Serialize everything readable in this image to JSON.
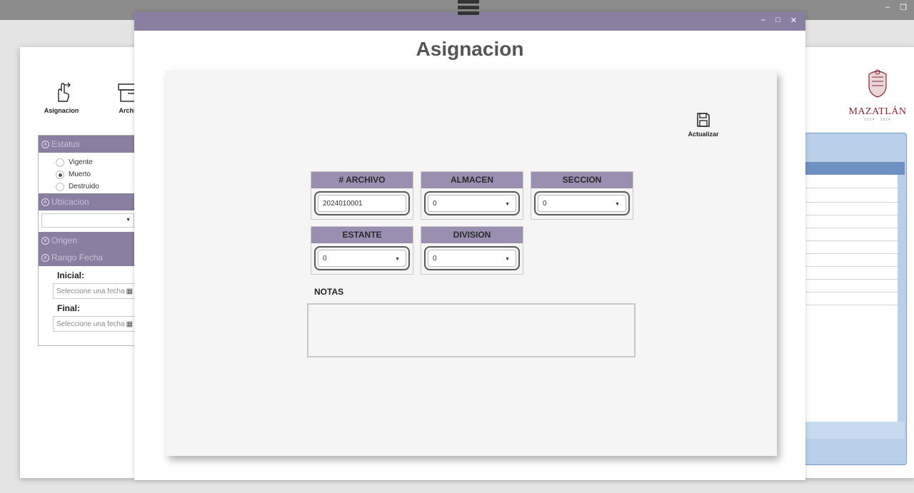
{
  "background_window": {
    "toolbar": [
      {
        "label": "Asignacion",
        "icon": "hand-pointer-icon"
      },
      {
        "label": "Archi",
        "icon": "archive-box-icon"
      }
    ],
    "logo": {
      "text": "MAZATLÁN",
      "subtext": "2024 · 2024"
    },
    "filters": {
      "estatus": {
        "header": "Estatus",
        "options": [
          {
            "label": "Vigente",
            "selected": false
          },
          {
            "label": "Muerto",
            "selected": true
          },
          {
            "label": "Destruido",
            "selected": false
          }
        ]
      },
      "ubicacion": {
        "header": "Ubicacion"
      },
      "origen": {
        "header": "Origen"
      },
      "rango_fecha": {
        "header": "Rango Fecha",
        "inicial_label": "Inicial:",
        "inicial_placeholder": "Seleccione una fecha",
        "final_label": "Final:",
        "final_placeholder": "Seleccione una fecha"
      }
    }
  },
  "dialog": {
    "title": "Asignacion",
    "save_label": "Actualizar",
    "fields": {
      "archivo": {
        "label": "# ARCHIVO",
        "value": "2024010001"
      },
      "almacen": {
        "label": "ALMACEN",
        "value": "0"
      },
      "seccion": {
        "label": "SECCION",
        "value": "0"
      },
      "estante": {
        "label": "ESTANTE",
        "value": "0"
      },
      "division": {
        "label": "DIVISION",
        "value": "0"
      }
    },
    "notas_label": "NOTAS",
    "notas_value": ""
  },
  "colors": {
    "accent": "#8a7fa0",
    "field_header": "#9b8fb1",
    "logo_red": "#8a2432",
    "panel_blue": "#6f91c2"
  }
}
